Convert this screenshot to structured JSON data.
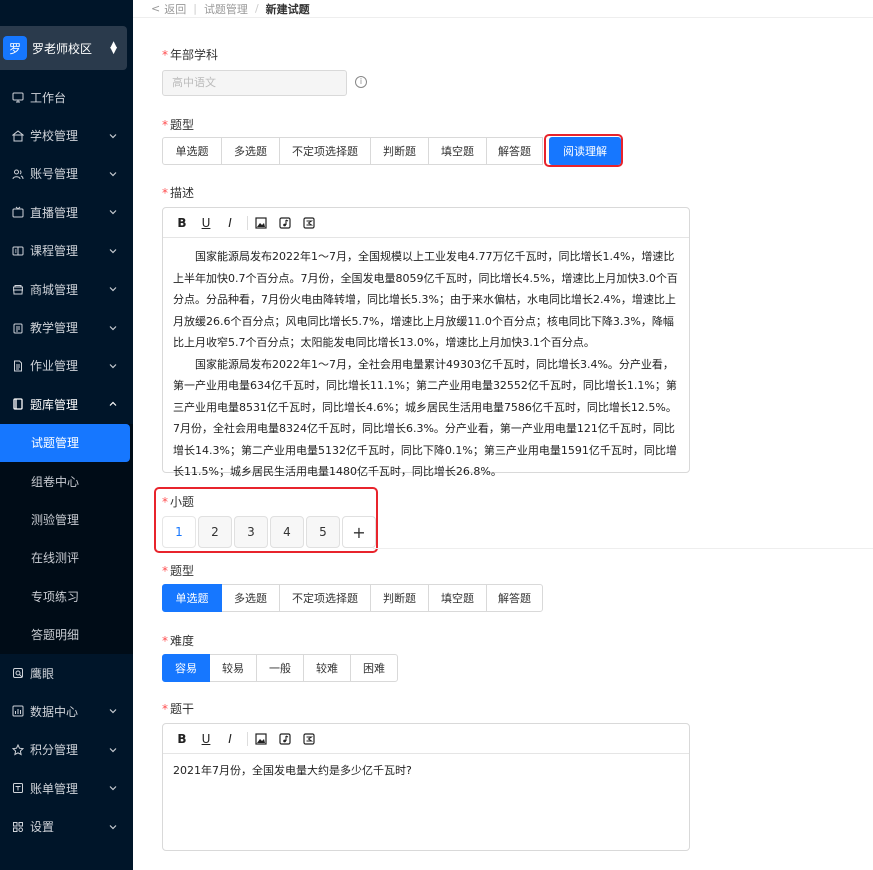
{
  "campus": {
    "logo_char": "罗",
    "name": "罗老师校区"
  },
  "menu": [
    {
      "key": "workbench",
      "label": "工作台",
      "icon": "monitor-icon",
      "has_chevron": false
    },
    {
      "key": "school",
      "label": "学校管理",
      "icon": "school-icon",
      "has_chevron": true
    },
    {
      "key": "account",
      "label": "账号管理",
      "icon": "users-icon",
      "has_chevron": true
    },
    {
      "key": "live",
      "label": "直播管理",
      "icon": "tv-icon",
      "has_chevron": true
    },
    {
      "key": "course",
      "label": "课程管理",
      "icon": "book-icon",
      "has_chevron": true
    },
    {
      "key": "mall",
      "label": "商城管理",
      "icon": "store-icon",
      "has_chevron": true
    },
    {
      "key": "teaching",
      "label": "教学管理",
      "icon": "clipboard-icon",
      "has_chevron": true
    },
    {
      "key": "homework",
      "label": "作业管理",
      "icon": "document-icon",
      "has_chevron": true
    },
    {
      "key": "question_bank",
      "label": "题库管理",
      "icon": "notebook-icon",
      "has_chevron": true,
      "open": true
    }
  ],
  "submenu": [
    {
      "label": "试题管理",
      "active": true
    },
    {
      "label": "组卷中心"
    },
    {
      "label": "测验管理"
    },
    {
      "label": "在线测评"
    },
    {
      "label": "专项练习"
    },
    {
      "label": "答题明细"
    }
  ],
  "menu_after": [
    {
      "key": "eagle",
      "label": "鹰眼",
      "icon": "eye-icon",
      "has_chevron": false
    },
    {
      "key": "data",
      "label": "数据中心",
      "icon": "chart-icon",
      "has_chevron": true
    },
    {
      "key": "points",
      "label": "积分管理",
      "icon": "star-icon",
      "has_chevron": true
    },
    {
      "key": "bill",
      "label": "账单管理",
      "icon": "receipt-icon",
      "has_chevron": true
    },
    {
      "key": "settings",
      "label": "设置",
      "icon": "grid-icon",
      "has_chevron": true
    }
  ],
  "breadcrumb": {
    "back": "返回",
    "parent": "试题管理",
    "current": "新建试题"
  },
  "form": {
    "grade_label": "年部学科",
    "grade_placeholder": "高中语文",
    "type_label": "题型",
    "types": [
      "单选题",
      "多选题",
      "不定项选择题",
      "判断题",
      "填空题",
      "解答题",
      "阅读理解"
    ],
    "selected_type": "阅读理解",
    "desc_label": "描述",
    "desc_paragraphs": [
      "国家能源局发布2022年1～7月，全国规模以上工业发电4.77万亿千瓦时，同比增长1.4%，增速比上半年加快0.7个百分点。7月份，全国发电量8059亿千瓦时，同比增长4.5%，增速比上月加快3.0个百分点。分品种看，7月份火电由降转增，同比增长5.3%；由于来水偏枯，水电同比增长2.4%，增速比上月放缓26.6个百分点；风电同比增长5.7%，增速比上月放缓11.0个百分点；核电同比下降3.3%，降幅比上月收窄5.7个百分点；太阳能发电同比增长13.0%，增速比上月加快3.1个百分点。",
      "国家能源局发布2022年1～7月，全社会用电量累计49303亿千瓦时，同比增长3.4%。分产业看，第一产业用电量634亿千瓦时，同比增长11.1%；第二产业用电量32552亿千瓦时，同比增长1.1%；第三产业用电量8531亿千瓦时，同比增长4.6%；城乡居民生活用电量7586亿千瓦时，同比增长12.5%。7月份，全社会用电量8324亿千瓦时，同比增长6.3%。分产业看，第一产业用电量121亿千瓦时，同比增长14.3%；第二产业用电量5132亿千瓦时，同比下降0.1%；第三产业用电量1591亿千瓦时，同比增长11.5%；城乡居民生活用电量1480亿千瓦时，同比增长26.8%。"
    ],
    "subq_label": "小题",
    "subq_numbers": [
      "1",
      "2",
      "3",
      "4",
      "5"
    ],
    "subq_add": "+",
    "subq_current": "1",
    "sub_type_label": "题型",
    "sub_types": [
      "单选题",
      "多选题",
      "不定项选择题",
      "判断题",
      "填空题",
      "解答题"
    ],
    "sub_selected_type": "单选题",
    "difficulty_label": "难度",
    "difficulties": [
      "容易",
      "较易",
      "一般",
      "较难",
      "困难"
    ],
    "selected_difficulty": "容易",
    "stem_label": "题干",
    "stem_text": "2021年7月份，全国发电量大约是多少亿千瓦时?"
  },
  "toolbar": {
    "bold": "B",
    "underline": "U",
    "italic": "I"
  },
  "colors": {
    "sidebar_bg": "#001529",
    "accent": "#1677ff",
    "highlight": "#e8242c",
    "required": "#ff4d4f"
  }
}
